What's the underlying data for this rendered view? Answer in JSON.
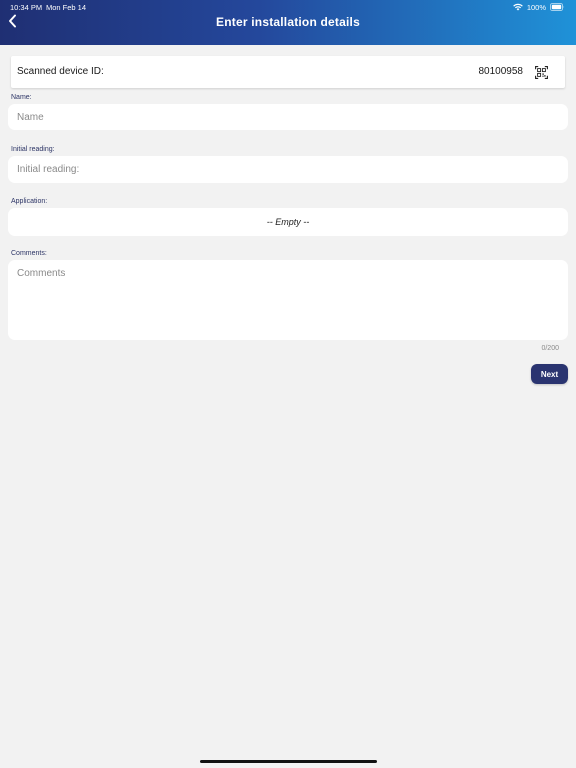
{
  "status_bar": {
    "time": "10:34 PM",
    "date": "Mon Feb 14",
    "battery": "100%"
  },
  "header": {
    "title": "Enter installation details",
    "back_icon": "chevron-left-icon",
    "gradient_colors": [
      "#1f2f73",
      "#24489c",
      "#1f92d8"
    ]
  },
  "device": {
    "label": "Scanned device ID:",
    "value": "80100958",
    "scan_icon": "qr-code-icon"
  },
  "form": {
    "name": {
      "label": "Name:",
      "placeholder": "Name",
      "value": ""
    },
    "initial_reading": {
      "label": "Initial reading:",
      "placeholder": "Initial reading:",
      "value": ""
    },
    "application": {
      "label": "Application:",
      "value": "-- Empty --"
    },
    "comments": {
      "label": "Comments:",
      "placeholder": "Comments",
      "value": "",
      "counter": "0/200"
    }
  },
  "actions": {
    "next_label": "Next",
    "next_color": "#2a3470"
  }
}
